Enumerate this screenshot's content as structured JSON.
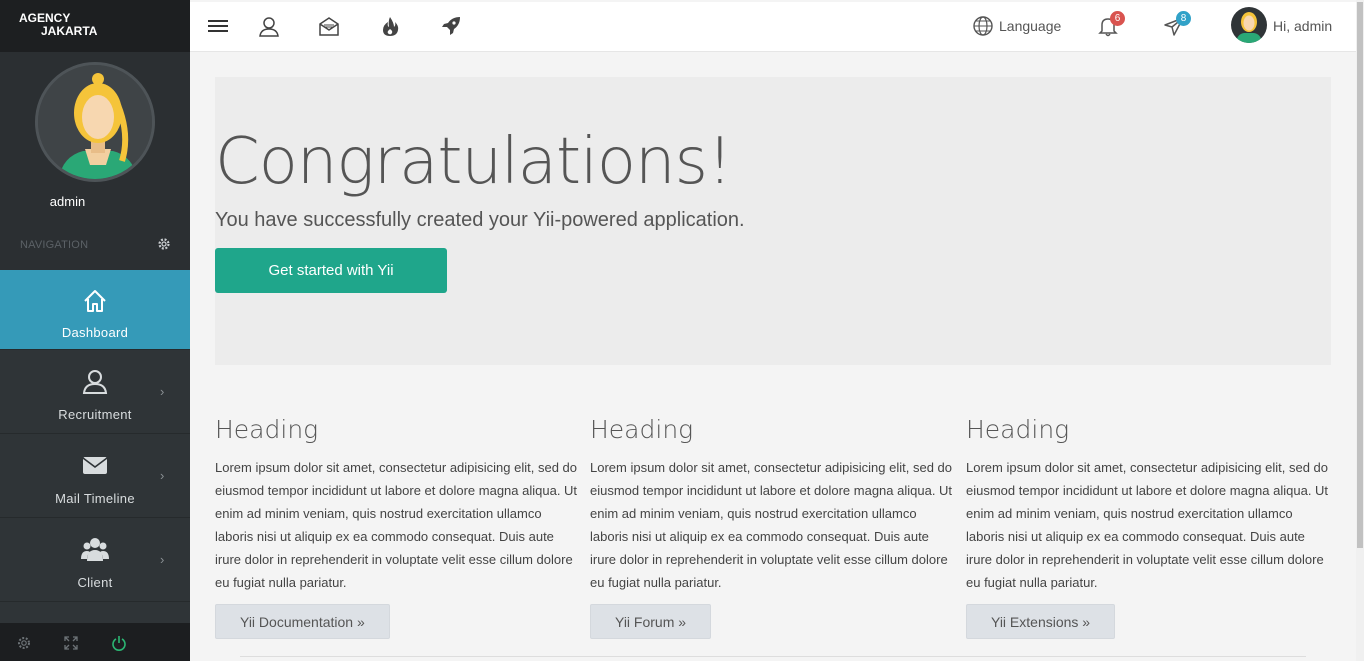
{
  "brand": {
    "line1": "AGENCY",
    "line2": "JAKARTA"
  },
  "profile": {
    "username": "admin",
    "nav_label": "NAVIGATION"
  },
  "sidebar": {
    "items": [
      {
        "label": "Dashboard",
        "icon": "home-icon",
        "active": true
      },
      {
        "label": "Recruitment",
        "icon": "user-icon"
      },
      {
        "label": "Mail Timeline",
        "icon": "envelope-icon"
      },
      {
        "label": "Client",
        "icon": "users-icon"
      }
    ],
    "footer_icons": [
      "gear-icon",
      "expand-icon",
      "power-icon"
    ]
  },
  "topbar": {
    "icons": [
      "menu-icon",
      "user-icon",
      "mail-open-icon",
      "fire-icon",
      "rocket-icon"
    ],
    "language_label": "Language",
    "notifications_count": "6",
    "messages_count": "8",
    "greeting": "Hi, admin"
  },
  "jumbotron": {
    "title": "Congratulations!",
    "lead": "You have successfully created your Yii-powered application.",
    "button": "Get started with Yii"
  },
  "columns": [
    {
      "heading": "Heading",
      "text": "Lorem ipsum dolor sit amet, consectetur adipisicing elit, sed do eiusmod tempor incididunt ut labore et dolore magna aliqua. Ut enim ad minim veniam, quis nostrud exercitation ullamco laboris nisi ut aliquip ex ea commodo consequat. Duis aute irure dolor in reprehenderit in voluptate velit esse cillum dolore eu fugiat nulla pariatur.",
      "button": "Yii Documentation »"
    },
    {
      "heading": "Heading",
      "text": "Lorem ipsum dolor sit amet, consectetur adipisicing elit, sed do eiusmod tempor incididunt ut labore et dolore magna aliqua. Ut enim ad minim veniam, quis nostrud exercitation ullamco laboris nisi ut aliquip ex ea commodo consequat. Duis aute irure dolor in reprehenderit in voluptate velit esse cillum dolore eu fugiat nulla pariatur.",
      "button": "Yii Forum »"
    },
    {
      "heading": "Heading",
      "text": "Lorem ipsum dolor sit amet, consectetur adipisicing elit, sed do eiusmod tempor incididunt ut labore et dolore magna aliqua. Ut enim ad minim veniam, quis nostrud exercitation ullamco laboris nisi ut aliquip ex ea commodo consequat. Duis aute irure dolor in reprehenderit in voluptate velit esse cillum dolore eu fugiat nulla pariatur.",
      "button": "Yii Extensions »"
    }
  ],
  "colors": {
    "sidebar": "#2f3437",
    "active": "#359ab8",
    "primary_button": "#1fa68b",
    "badge_red": "#d9534f",
    "badge_blue": "#31a2c8"
  }
}
